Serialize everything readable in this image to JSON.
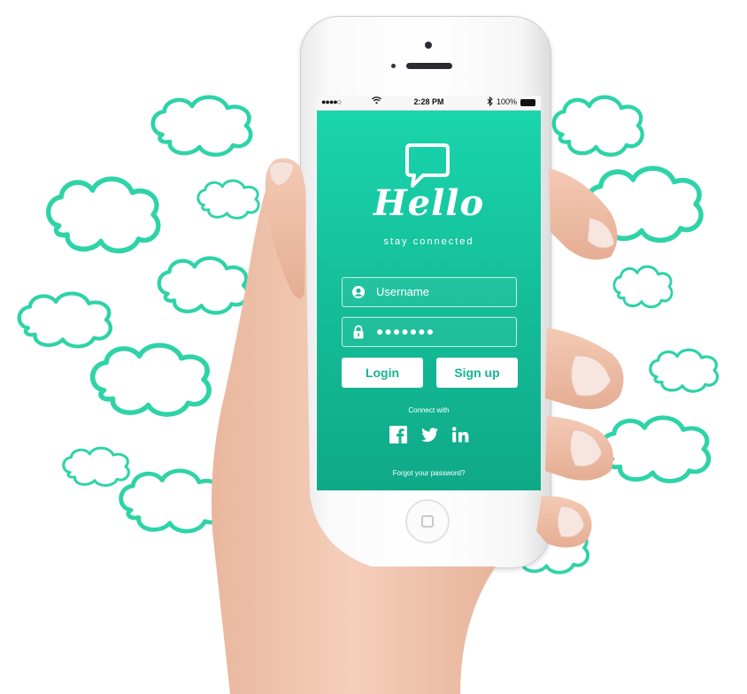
{
  "status_bar": {
    "signal": "●●●●○",
    "wifi_icon": "wifi-icon",
    "time": "2:28 PM",
    "bluetooth_icon": "bluetooth-icon",
    "battery": "100%"
  },
  "app": {
    "title": "Hello",
    "tagline": "stay connected",
    "brand_color": "#17c9a2",
    "cloud_color": "#2ed3a8"
  },
  "login_form": {
    "username_placeholder": "Username",
    "password_value": "●●●●●●●",
    "login_label": "Login",
    "signup_label": "Sign up"
  },
  "social": {
    "label": "Connect with",
    "networks": [
      "facebook-icon",
      "twitter-icon",
      "linkedin-icon"
    ]
  },
  "forgot_password": "Forgot your password?"
}
